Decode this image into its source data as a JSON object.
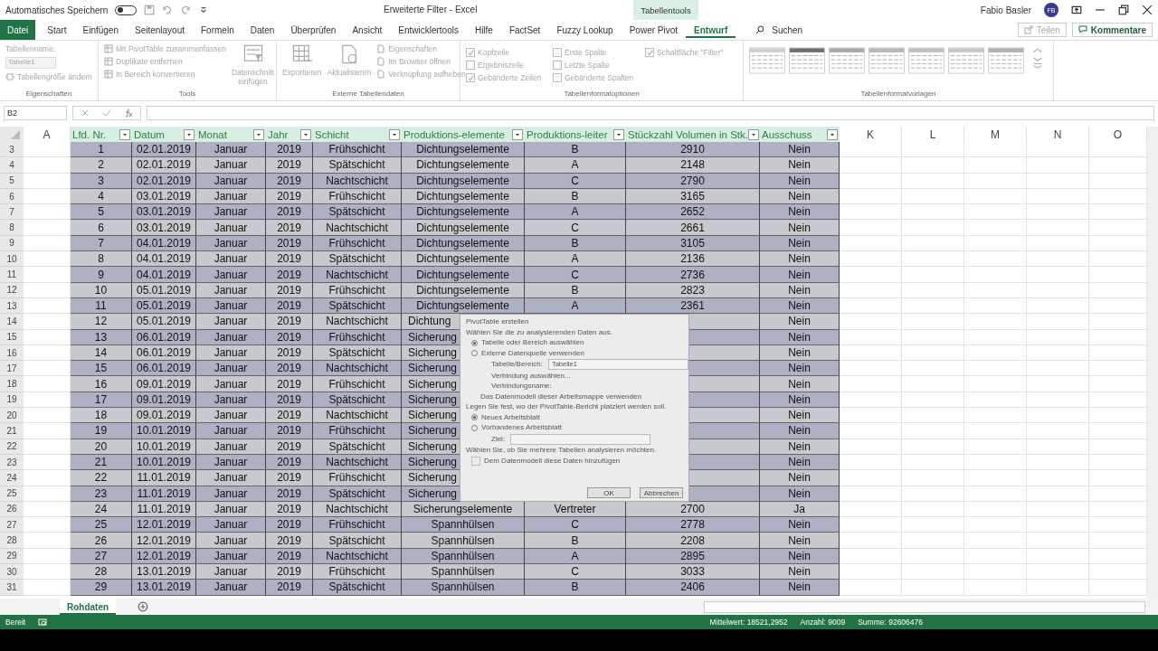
{
  "title_bar": {
    "autosave_label": "Automatisches Speichern",
    "autosave_on": false,
    "title": "Erweiterte Filter  -  Excel",
    "context_tab": "Tabellentools",
    "user": "Fabio Basler",
    "avatar": "FB"
  },
  "file_tab": "Datei",
  "ribbon_tabs": [
    {
      "label": "Start",
      "selected": false
    },
    {
      "label": "Einfügen",
      "selected": false
    },
    {
      "label": "Seitenlayout",
      "selected": false
    },
    {
      "label": "Formeln",
      "selected": false
    },
    {
      "label": "Daten",
      "selected": false
    },
    {
      "label": "Überprüfen",
      "selected": false
    },
    {
      "label": "Ansicht",
      "selected": false
    },
    {
      "label": "Entwicklertools",
      "selected": false
    },
    {
      "label": "Hilfe",
      "selected": false
    },
    {
      "label": "FactSet",
      "selected": false
    },
    {
      "label": "Fuzzy Lookup",
      "selected": false
    },
    {
      "label": "Power Pivot",
      "selected": false
    },
    {
      "label": "Entwurf",
      "selected": true
    }
  ],
  "search": {
    "label": "Suchen"
  },
  "share_button": "Teilen",
  "comments_button": "Kommentare",
  "ribbon": {
    "eigenschaften": {
      "name_label": "Tabellenname:",
      "name_value": "Tabelle1",
      "resize": "Tabellengröße ändern",
      "title": "Eigenschaften"
    },
    "tools": {
      "items": [
        "Mit PivotTable zusammenfassen",
        "Duplikate entfernen",
        "In Bereich konvertieren"
      ],
      "slicer": "Datenschnitt einfügen",
      "title": "Tools"
    },
    "extern": {
      "export": "Exportieren",
      "refresh": "Aktualisieren",
      "items": [
        "Eigenschaften",
        "Im Browser öffnen",
        "Verknüpfung aufheben"
      ],
      "title": "Externe Tabellendaten"
    },
    "options": {
      "checks": [
        {
          "label": "Kopfzeile",
          "checked": true
        },
        {
          "label": "Ergebniszeile",
          "checked": false
        },
        {
          "label": "Gebänderte Zeilen",
          "checked": true
        },
        {
          "label": "Erste Spalte",
          "checked": false
        },
        {
          "label": "Letzte Spalte",
          "checked": false
        },
        {
          "label": "Gebänderte Spalten",
          "checked": false
        },
        {
          "label": "Schaltfläche \"Filter\"",
          "checked": true
        }
      ],
      "title": "Tabellenformatoptionen"
    },
    "styles": {
      "title": "Tabellenformatvorlagen"
    }
  },
  "formula_bar": {
    "name_box": "B2"
  },
  "columns": [
    {
      "label": "A",
      "kind": "letter"
    },
    {
      "label": "Lfd. Nr.",
      "kind": "table"
    },
    {
      "label": "Datum",
      "kind": "table"
    },
    {
      "label": "Monat",
      "kind": "table"
    },
    {
      "label": "Jahr",
      "kind": "table"
    },
    {
      "label": "Schicht",
      "kind": "table"
    },
    {
      "label": "Produktions-elemente",
      "kind": "table"
    },
    {
      "label": "Produktions-leiter",
      "kind": "table"
    },
    {
      "label": "Stückzahl Volumen in Stk.",
      "kind": "table"
    },
    {
      "label": "Ausschuss",
      "kind": "table"
    },
    {
      "label": "K",
      "kind": "letter"
    },
    {
      "label": "L",
      "kind": "letter"
    },
    {
      "label": "M",
      "kind": "letter"
    },
    {
      "label": "N",
      "kind": "letter"
    },
    {
      "label": "O",
      "kind": "letter"
    }
  ],
  "rows": [
    {
      "number": "3",
      "nr": "1",
      "datum": "02.01.2019",
      "monat": "Januar",
      "jahr": "2019",
      "schicht": "Frühschicht",
      "elemente": "Dichtungselemente",
      "leiter": "B",
      "stueck": "2910",
      "ausschuss": "Nein"
    },
    {
      "number": "4",
      "nr": "2",
      "datum": "02.01.2019",
      "monat": "Januar",
      "jahr": "2019",
      "schicht": "Spätschicht",
      "elemente": "Dichtungselemente",
      "leiter": "A",
      "stueck": "2148",
      "ausschuss": "Nein"
    },
    {
      "number": "5",
      "nr": "3",
      "datum": "02.01.2019",
      "monat": "Januar",
      "jahr": "2019",
      "schicht": "Nachtschicht",
      "elemente": "Dichtungselemente",
      "leiter": "C",
      "stueck": "2790",
      "ausschuss": "Nein"
    },
    {
      "number": "6",
      "nr": "4",
      "datum": "03.01.2019",
      "monat": "Januar",
      "jahr": "2019",
      "schicht": "Frühschicht",
      "elemente": "Dichtungselemente",
      "leiter": "B",
      "stueck": "3165",
      "ausschuss": "Nein"
    },
    {
      "number": "7",
      "nr": "5",
      "datum": "03.01.2019",
      "monat": "Januar",
      "jahr": "2019",
      "schicht": "Spätschicht",
      "elemente": "Dichtungselemente",
      "leiter": "A",
      "stueck": "2652",
      "ausschuss": "Nein"
    },
    {
      "number": "8",
      "nr": "6",
      "datum": "03.01.2019",
      "monat": "Januar",
      "jahr": "2019",
      "schicht": "Nachtschicht",
      "elemente": "Dichtungselemente",
      "leiter": "C",
      "stueck": "2661",
      "ausschuss": "Nein"
    },
    {
      "number": "9",
      "nr": "7",
      "datum": "04.01.2019",
      "monat": "Januar",
      "jahr": "2019",
      "schicht": "Frühschicht",
      "elemente": "Dichtungselemente",
      "leiter": "B",
      "stueck": "3105",
      "ausschuss": "Nein"
    },
    {
      "number": "10",
      "nr": "8",
      "datum": "04.01.2019",
      "monat": "Januar",
      "jahr": "2019",
      "schicht": "Spätschicht",
      "elemente": "Dichtungselemente",
      "leiter": "A",
      "stueck": "2136",
      "ausschuss": "Nein"
    },
    {
      "number": "11",
      "nr": "9",
      "datum": "04.01.2019",
      "monat": "Januar",
      "jahr": "2019",
      "schicht": "Nachtschicht",
      "elemente": "Dichtungselemente",
      "leiter": "C",
      "stueck": "2736",
      "ausschuss": "Nein"
    },
    {
      "number": "12",
      "nr": "10",
      "datum": "05.01.2019",
      "monat": "Januar",
      "jahr": "2019",
      "schicht": "Frühschicht",
      "elemente": "Dichtungselemente",
      "leiter": "B",
      "stueck": "2823",
      "ausschuss": "Nein"
    },
    {
      "number": "13",
      "nr": "11",
      "datum": "05.01.2019",
      "monat": "Januar",
      "jahr": "2019",
      "schicht": "Spätschicht",
      "elemente": "Dichtungselemente",
      "leiter": "A",
      "stueck": "2361",
      "ausschuss": "Nein"
    },
    {
      "number": "14",
      "nr": "12",
      "datum": "05.01.2019",
      "monat": "Januar",
      "jahr": "2019",
      "schicht": "Nachtschicht",
      "elemente": "Dichtung",
      "ausschuss": "Nein"
    },
    {
      "number": "15",
      "nr": "13",
      "datum": "06.01.2019",
      "monat": "Januar",
      "jahr": "2019",
      "schicht": "Frühschicht",
      "elemente": "Sicherung",
      "ausschuss": "Nein"
    },
    {
      "number": "16",
      "nr": "14",
      "datum": "06.01.2019",
      "monat": "Januar",
      "jahr": "2019",
      "schicht": "Spätschicht",
      "elemente": "Sicherung",
      "ausschuss": "Nein"
    },
    {
      "number": "17",
      "nr": "15",
      "datum": "06.01.2019",
      "monat": "Januar",
      "jahr": "2019",
      "schicht": "Nachtschicht",
      "elemente": "Sicherung",
      "ausschuss": "Nein"
    },
    {
      "number": "18",
      "nr": "16",
      "datum": "09.01.2019",
      "monat": "Januar",
      "jahr": "2019",
      "schicht": "Frühschicht",
      "elemente": "Sicherung",
      "ausschuss": "Nein"
    },
    {
      "number": "19",
      "nr": "17",
      "datum": "09.01.2019",
      "monat": "Januar",
      "jahr": "2019",
      "schicht": "Spätschicht",
      "elemente": "Sicherung",
      "ausschuss": "Nein"
    },
    {
      "number": "20",
      "nr": "18",
      "datum": "09.01.2019",
      "monat": "Januar",
      "jahr": "2019",
      "schicht": "Nachtschicht",
      "elemente": "Sicherung",
      "ausschuss": "Nein"
    },
    {
      "number": "21",
      "nr": "19",
      "datum": "10.01.2019",
      "monat": "Januar",
      "jahr": "2019",
      "schicht": "Frühschicht",
      "elemente": "Sicherung",
      "ausschuss": "Nein"
    },
    {
      "number": "22",
      "nr": "20",
      "datum": "10.01.2019",
      "monat": "Januar",
      "jahr": "2019",
      "schicht": "Spätschicht",
      "elemente": "Sicherung",
      "ausschuss": "Nein"
    },
    {
      "number": "23",
      "nr": "21",
      "datum": "10.01.2019",
      "monat": "Januar",
      "jahr": "2019",
      "schicht": "Nachtschicht",
      "elemente": "Sicherung",
      "ausschuss": "Nein"
    },
    {
      "number": "24",
      "nr": "22",
      "datum": "11.01.2019",
      "monat": "Januar",
      "jahr": "2019",
      "schicht": "Frühschicht",
      "elemente": "Sicherung",
      "ausschuss": "Nein"
    },
    {
      "number": "25",
      "nr": "23",
      "datum": "11.01.2019",
      "monat": "Januar",
      "jahr": "2019",
      "schicht": "Spätschicht",
      "elemente": "Sicherung",
      "ausschuss": "Nein"
    },
    {
      "number": "26",
      "nr": "24",
      "datum": "11.01.2019",
      "monat": "Januar",
      "jahr": "2019",
      "schicht": "Nachtschicht",
      "elemente": "Sicherungselemente",
      "leiter": "Vertreter",
      "stueck": "2700",
      "ausschuss": "Ja"
    },
    {
      "number": "27",
      "nr": "25",
      "datum": "12.01.2019",
      "monat": "Januar",
      "jahr": "2019",
      "schicht": "Frühschicht",
      "elemente": "Spannhülsen",
      "leiter": "C",
      "stueck": "2778",
      "ausschuss": "Nein"
    },
    {
      "number": "28",
      "nr": "26",
      "datum": "12.01.2019",
      "monat": "Januar",
      "jahr": "2019",
      "schicht": "Spätschicht",
      "elemente": "Spannhülsen",
      "leiter": "B",
      "stueck": "2208",
      "ausschuss": "Nein"
    },
    {
      "number": "29",
      "nr": "27",
      "datum": "12.01.2019",
      "monat": "Januar",
      "jahr": "2019",
      "schicht": "Nachtschicht",
      "elemente": "Spannhülsen",
      "leiter": "A",
      "stueck": "2895",
      "ausschuss": "Nein"
    },
    {
      "number": "30",
      "nr": "28",
      "datum": "13.01.2019",
      "monat": "Januar",
      "jahr": "2019",
      "schicht": "Frühschicht",
      "elemente": "Spannhülsen",
      "leiter": "C",
      "stueck": "3033",
      "ausschuss": "Nein"
    },
    {
      "number": "31",
      "nr": "29",
      "datum": "13.01.2019",
      "monat": "Januar",
      "jahr": "2019",
      "schicht": "Spätschicht",
      "elemente": "Spannhülsen",
      "leiter": "B",
      "stueck": "2406",
      "ausschuss": "Nein"
    }
  ],
  "dialog": {
    "title": "PivotTable erstellen",
    "section1": "Wählen Sie die zu analysierenden Daten aus.",
    "source_options": [
      {
        "label": "Tabelle oder Bereich auswählen",
        "selected": true
      },
      {
        "label": "Externe Datenquelle verwenden",
        "selected": false
      }
    ],
    "range_label": "Tabelle/Bereich:",
    "range_value": "Tabelle1",
    "connection_button": "Verbindung auswählen...",
    "connection_name": "Verbindungsname:",
    "model_option": "Das Datenmodell dieser Arbeitsmappe verwenden",
    "section2": "Legen Sie fest, wo der PivotTable-Bericht platziert werden soll.",
    "target_options": [
      {
        "label": "Neues Arbeitsblatt",
        "selected": true
      },
      {
        "label": "Vorhandenes Arbeitsblatt",
        "selected": false
      }
    ],
    "target_label": "Ziel:",
    "section3": "Wählen Sie, ob Sie mehrere Tabellen analysieren möchten.",
    "add_model": {
      "label": "Dem Datenmodell diese Daten hinzufügen",
      "checked": false
    },
    "ok": "OK",
    "cancel": "Abbrechen"
  },
  "sheet_tabs": [
    {
      "label": "Rohdaten",
      "selected": true
    }
  ],
  "status_bar": {
    "ready": "Bereit",
    "average": "Mittelwert: 18521,2952",
    "count": "Anzahl: 9009",
    "sum": "Summe: 92606476"
  }
}
